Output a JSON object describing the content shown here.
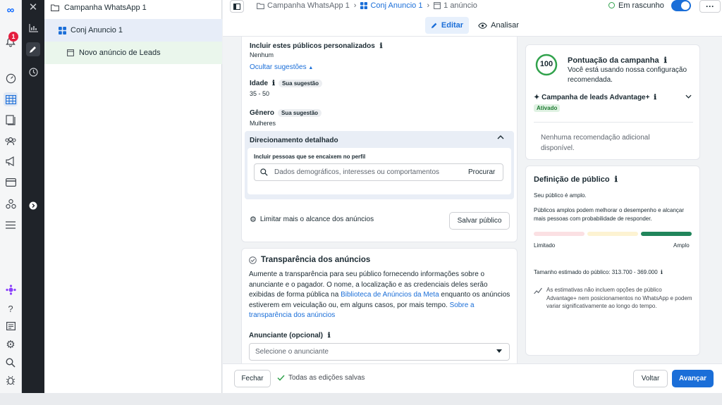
{
  "rail": {
    "notification_count": "1"
  },
  "tree": {
    "campaign": "Campanha WhatsApp 1",
    "adset": "Conj Anuncio 1",
    "ad": "Novo anúncio de Leads"
  },
  "topbar": {
    "crumb_campaign": "Campanha WhatsApp 1",
    "crumb_adset": "Conj Anuncio 1",
    "crumb_ad": "1 anúncio",
    "status": "Em rascunho",
    "edit_tab": "Editar",
    "review_tab": "Analisar"
  },
  "audience": {
    "custom_label": "Incluir estes públicos personalizados",
    "custom_value": "Nenhum",
    "hide_suggestions": "Ocultar sugestões",
    "age_label": "Idade",
    "age_chip": "Sua sugestão",
    "age_value": "35 - 50",
    "gender_label": "Gênero",
    "gender_chip": "Sua sugestão",
    "gender_value": "Mulheres"
  },
  "detailed": {
    "title": "Direcionamento detalhado",
    "include_label": "Incluir pessoas que se encaixem no perfil",
    "search_placeholder": "Dados demográficos, interesses ou comportamentos",
    "search_button": "Procurar",
    "limit_label": "Limitar mais o alcance dos anúncios",
    "save_button": "Salvar público"
  },
  "transparency": {
    "title": "Transparência dos anúncios",
    "text1": "Aumente a transparência para seu público fornecendo informações sobre o anunciante e o pagador. O nome, a localização e as credenciais deles serão exibidas de forma pública na",
    "link1": "Biblioteca de Anúncios da Meta",
    "text2": "enquanto os anúncios estiverem em veiculação ou, em alguns casos, por mais tempo.",
    "link2": "Sobre a transparência dos anúncios",
    "advertiser_label": "Anunciante (opcional)",
    "advertiser_placeholder": "Selecione o anunciante"
  },
  "score": {
    "value": "100",
    "title": "Pontuação da campanha",
    "desc": "Você está usando nossa configuração recomendada.",
    "advantage_label": "Campanha de leads Advantage+",
    "advantage_status": "Ativado",
    "no_recs": "Nenhuma recomendação adicional disponível."
  },
  "definition": {
    "title": "Definição de público",
    "broad": "Seu público é amplo.",
    "broad_desc": "Públicos amplos podem melhorar o desempenho e alcançar mais pessoas com probabilidade de responder.",
    "gauge_level": 1.0,
    "limited": "Limitado",
    "wide": "Amplo",
    "size": "Tamanho estimado do público: 313.700 - 369.000",
    "note": "As estimativas não incluem opções de público Advantage+ nem posicionamentos no WhatsApp e podem variar significativamente ao longo do tempo."
  },
  "footer": {
    "close": "Fechar",
    "saved": "Todas as edições salvas",
    "back": "Voltar",
    "next": "Avançar"
  },
  "colors": {
    "accent": "#1a6ed8",
    "success": "#31a24c",
    "dark_rail": "#1f2329"
  }
}
